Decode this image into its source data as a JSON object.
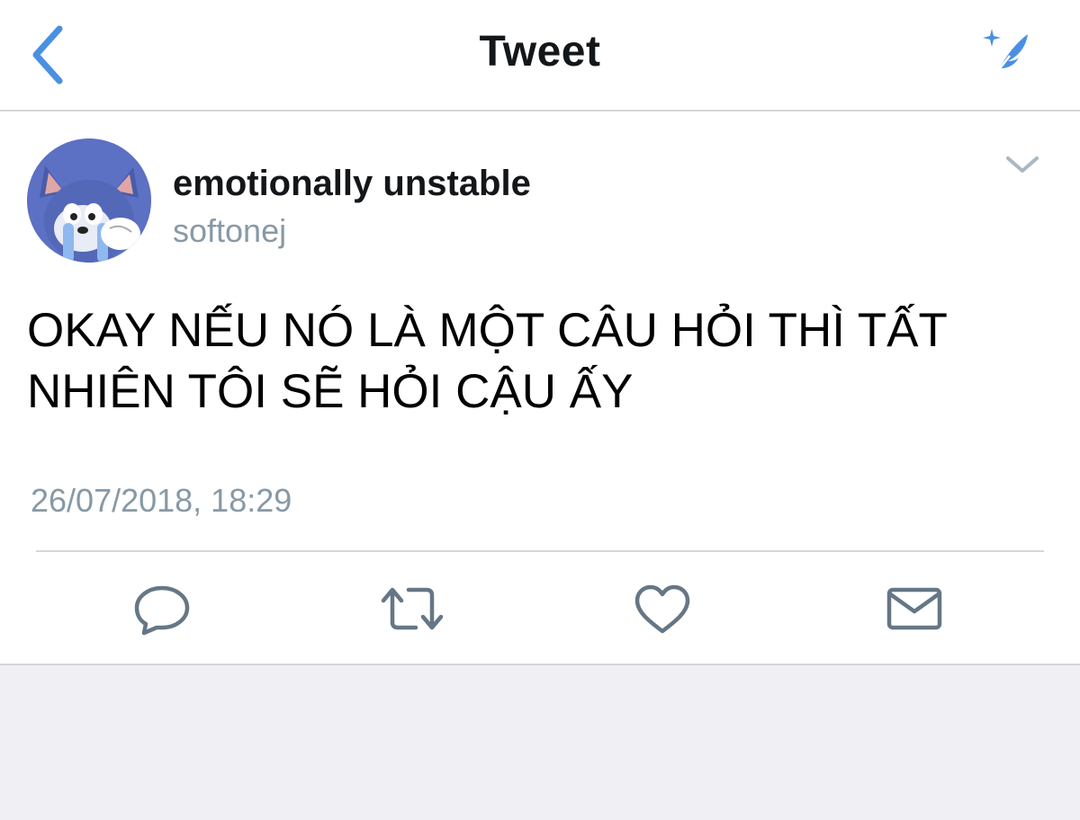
{
  "navbar": {
    "title": "Tweet",
    "back_icon": "chevron-left-icon",
    "compose_icon": "compose-tweet-icon"
  },
  "tweet": {
    "display_name": "emotionally unstable",
    "username": "softonej",
    "text": "OKAY NẾU NÓ LÀ MỘT CÂU HỎI THÌ TẤT NHIÊN TÔI SẼ HỎI CẬU ẤY",
    "timestamp": "26/07/2018, 18:29",
    "more_icon": "chevron-down-icon"
  },
  "actions": [
    {
      "name": "reply",
      "icon": "reply-icon"
    },
    {
      "name": "retweet",
      "icon": "retweet-icon"
    },
    {
      "name": "like",
      "icon": "heart-icon"
    },
    {
      "name": "direct-message",
      "icon": "envelope-icon"
    }
  ],
  "colors": {
    "accent": "#4a90e2",
    "text_primary": "#14171a",
    "text_secondary": "#8899a6",
    "icon_gray": "#657786",
    "separator": "#d6d6da",
    "background": "#efeff4"
  }
}
